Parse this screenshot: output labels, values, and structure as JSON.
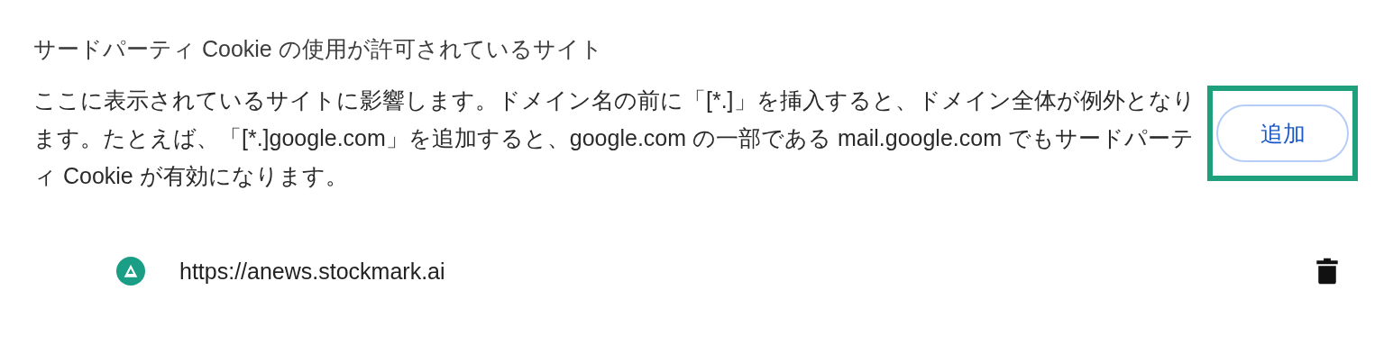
{
  "section": {
    "title": "サードパーティ Cookie の使用が許可されているサイト",
    "description": "ここに表示されているサイトに影響します。ドメイン名の前に「[*.]」を挿入すると、ドメイン全体が例外となります。たとえば、「[*.]google.com」を追加すると、google.com の一部である mail.google.com でもサードパーティ Cookie が有効になります。",
    "add_button": {
      "label": "追加",
      "highlighted": true
    }
  },
  "sites": [
    {
      "url": "https://anews.stockmark.ai"
    }
  ]
}
